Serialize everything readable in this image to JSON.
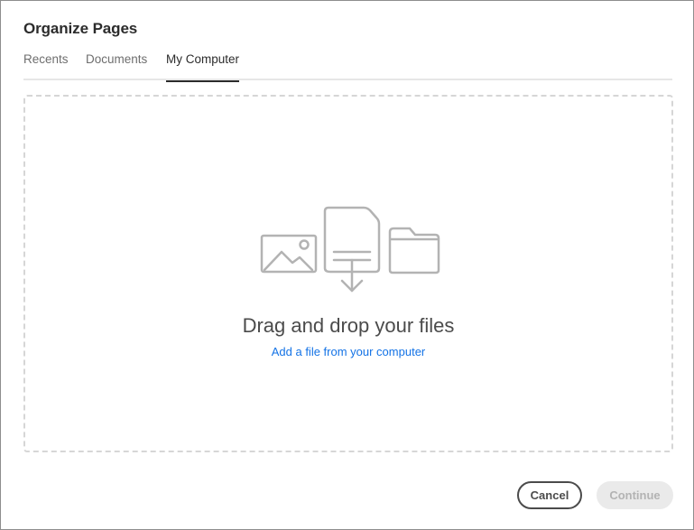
{
  "dialog": {
    "title": "Organize Pages",
    "tabs": [
      {
        "label": "Recents",
        "active": false
      },
      {
        "label": "Documents",
        "active": false
      },
      {
        "label": "My Computer",
        "active": true
      }
    ]
  },
  "dropzone": {
    "title": "Drag and drop your files",
    "link": "Add a file from your computer",
    "icons": [
      "image-icon",
      "file-download-icon",
      "folder-icon"
    ]
  },
  "footer": {
    "cancel_label": "Cancel",
    "continue_label": "Continue",
    "continue_disabled": true
  },
  "colors": {
    "link": "#1473e6",
    "icon_stroke": "#b3b3b3",
    "dashed_border": "#d6d6d6"
  }
}
